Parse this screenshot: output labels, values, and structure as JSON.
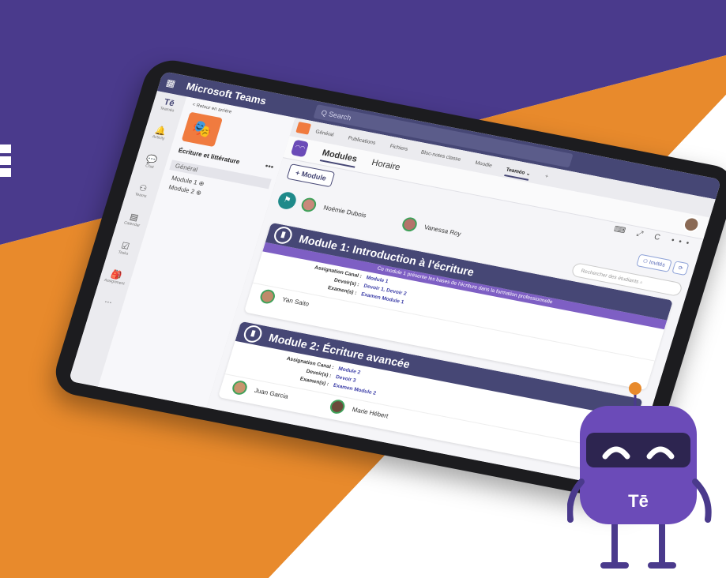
{
  "colors": {
    "purple": "#4a3a8c",
    "orange": "#e88a2c",
    "teams_header": "#464775",
    "module_desc": "#7e5fc4"
  },
  "titlebar": {
    "app_name": "Microsoft Teams",
    "search_placeholder": "Q  Search"
  },
  "rail": {
    "items": [
      "Teaméo",
      "Activity",
      "Chat",
      "Teams",
      "Calendar",
      "Tasks",
      "Assignment",
      "..."
    ]
  },
  "panel": {
    "back_label": "< Retour en arrière",
    "team_name": "Écriture et littérature",
    "more": "•••",
    "channels": [
      "Général",
      "Module 1 ⊕",
      "Module 2 ⊕"
    ]
  },
  "tabs": {
    "items": [
      "Général",
      "Publications",
      "Fichiers",
      "Bloc-notes classe",
      "Moodle",
      "Teaméo ⌄"
    ],
    "add": "+"
  },
  "module_tabs": [
    "Modules",
    "Horaire"
  ],
  "toolbar": {
    "add_module": "+ Module",
    "invites": "⚇ Invités",
    "refresh": "⟳",
    "search_students": "Rechercher des étudiants  ⌕",
    "icons": "⌨ ⤢ C •••"
  },
  "teachers": [
    "Noémie Dubois",
    "Vanessa Roy"
  ],
  "modules": [
    {
      "title": "Module 1: Introduction à l'écriture",
      "description": "Ce module 1 présente les bases de l'écriture dans la formation professionnelle",
      "rows": [
        {
          "label": "Assignation Canal :",
          "value": "Module 1"
        },
        {
          "label": "Devoir(s) :",
          "value": "Devoir 1, Devoir 2"
        },
        {
          "label": "Examen(s) :",
          "value": "Examen Module 1"
        }
      ],
      "students": [
        "Yan Saito"
      ]
    },
    {
      "title": "Module 2: Écriture avancée",
      "description": "",
      "rows": [
        {
          "label": "Assignation Canal :",
          "value": "Module 2"
        },
        {
          "label": "Devoir(s) :",
          "value": "Devoir 3"
        },
        {
          "label": "Examen(s) :",
          "value": "Examen Module 2"
        }
      ],
      "students": [
        "Juan Garcia",
        "Marie Hébert"
      ]
    }
  ],
  "mascot": {
    "logo": "Tē"
  }
}
